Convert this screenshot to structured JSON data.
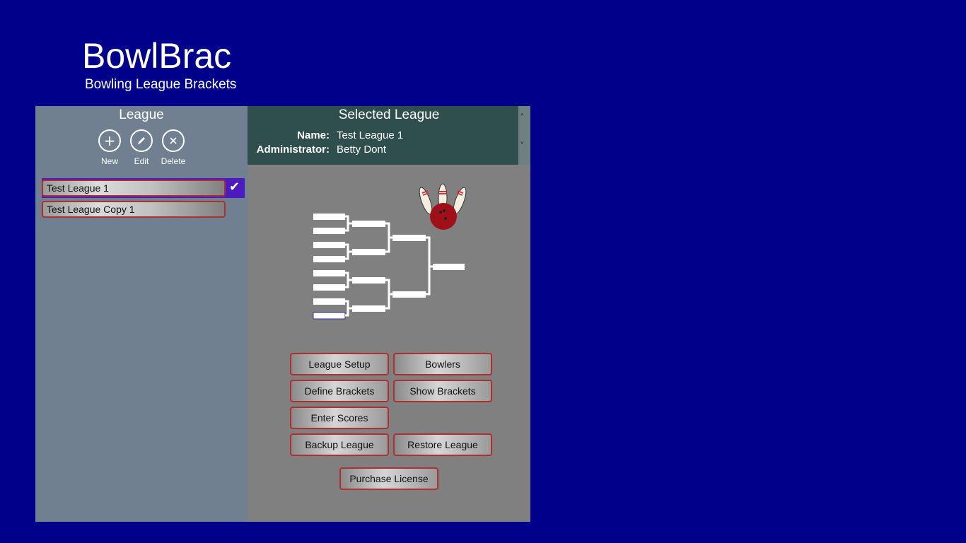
{
  "app": {
    "title": "BowlBrac",
    "subtitle": "Bowling League Brackets"
  },
  "colors": {
    "background": "#00008b",
    "left_panel": "#708090",
    "right_panel": "#808080",
    "header": "#2f4f4f",
    "selection": "#4b1bc0",
    "button_border": "#b03030"
  },
  "league_panel": {
    "title": "League",
    "commands": [
      {
        "label": "New",
        "icon": "plus-icon"
      },
      {
        "label": "Edit",
        "icon": "pencil-icon"
      },
      {
        "label": "Delete",
        "icon": "x-icon"
      }
    ],
    "items": [
      {
        "name": "Test League 1",
        "selected": true
      },
      {
        "name": "Test League Copy 1",
        "selected": false
      }
    ]
  },
  "selected_league": {
    "title": "Selected League",
    "name_label": "Name:",
    "name_value": "Test League 1",
    "admin_label": "Administrator:",
    "admin_value": "Betty Dont"
  },
  "actions": {
    "league_setup": "League Setup",
    "bowlers": "Bowlers",
    "define_brackets": "Define Brackets",
    "show_brackets": "Show Brackets",
    "enter_scores": "Enter Scores",
    "backup_league": "Backup League",
    "restore_league": "Restore League",
    "purchase_license": "Purchase License"
  }
}
